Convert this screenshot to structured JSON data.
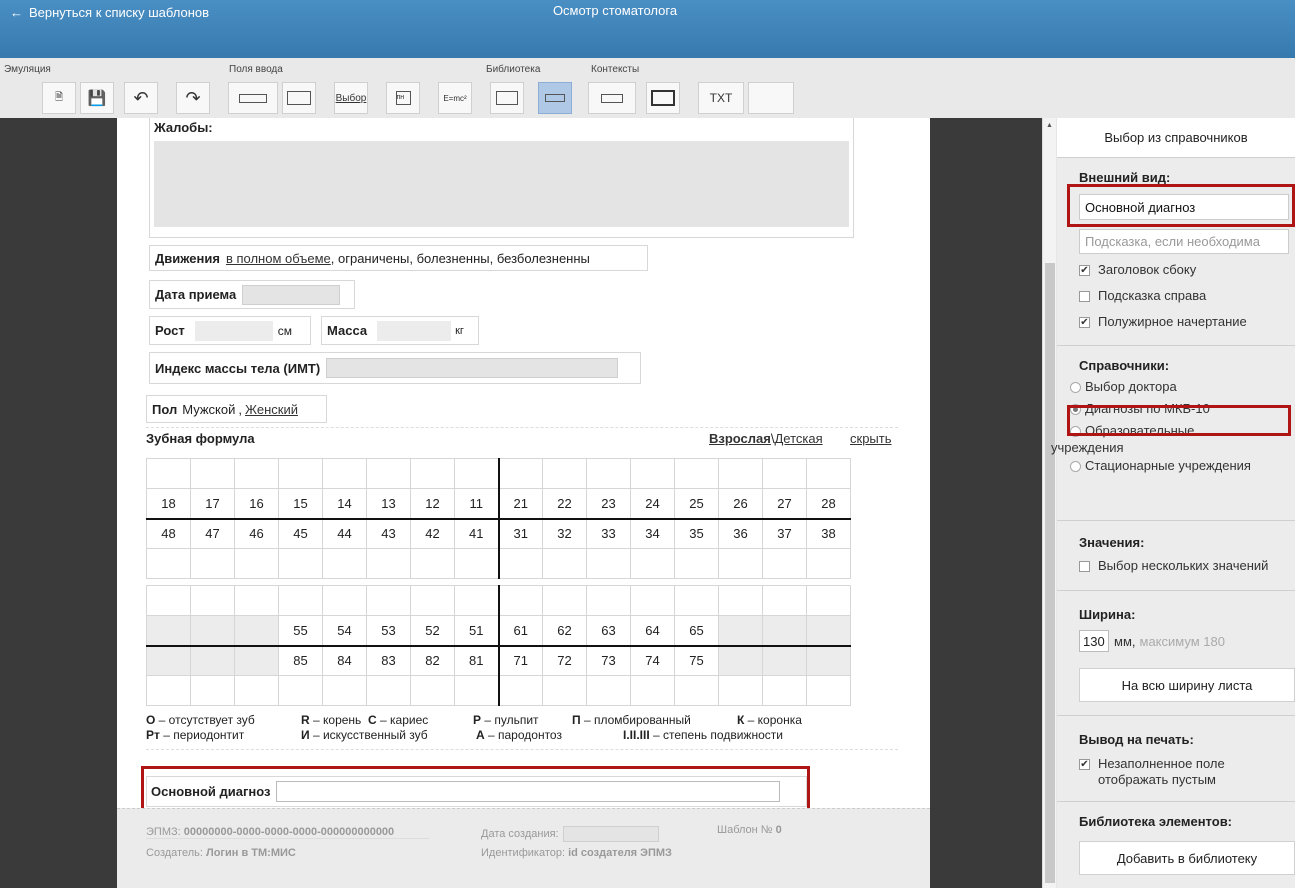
{
  "header": {
    "back_label": "Вернуться к списку шаблонов",
    "title": "Осмотр стоматолога"
  },
  "toolbar": {
    "groups": {
      "emulation": "Эмуляция",
      "input_fields": "Поля ввода",
      "library": "Библиотека",
      "contexts": "Контексты"
    },
    "choice_label": "Выбор",
    "pn_label": "пн",
    "formula_label": "E=mc²",
    "txt_label": "TXT"
  },
  "sheet": {
    "complaints_label": "Жалобы:",
    "movements": {
      "label": "Движения",
      "opt1": "в полном объеме",
      "rest": ", ограничены, болезненны, безболезненны"
    },
    "visit_date_label": "Дата приема",
    "height_label": "Рост",
    "height_unit": "см",
    "weight_label": "Масса",
    "weight_unit": "кг",
    "bmi_label": "Индекс массы тела (ИМТ)",
    "sex": {
      "label": "Пол",
      "opt1": "Мужской",
      "sep": ",",
      "opt2": "Женский"
    },
    "dental_formula": {
      "label": "Зубная формула",
      "adult": "Взрослая",
      "sep": "\\",
      "child": "Детская",
      "hide": "скрыть"
    },
    "teeth_upper": [
      "18",
      "17",
      "16",
      "15",
      "14",
      "13",
      "12",
      "11",
      "21",
      "22",
      "23",
      "24",
      "25",
      "26",
      "27",
      "28"
    ],
    "teeth_lower": [
      "48",
      "47",
      "46",
      "45",
      "44",
      "43",
      "42",
      "41",
      "31",
      "32",
      "33",
      "34",
      "35",
      "36",
      "37",
      "38"
    ],
    "milk_upper": [
      "",
      "",
      "",
      "55",
      "54",
      "53",
      "52",
      "51",
      "61",
      "62",
      "63",
      "64",
      "65",
      "",
      "",
      ""
    ],
    "milk_lower": [
      "",
      "",
      "",
      "85",
      "84",
      "83",
      "82",
      "81",
      "71",
      "72",
      "73",
      "74",
      "75",
      "",
      "",
      ""
    ],
    "legend": {
      "o_key": "О",
      "o_val": " – отсутствует зуб",
      "r_key": "R",
      "r_val": " – корень",
      "c_key": "C",
      "c_val": " – кариес",
      "p_key": "P",
      "p_val": " – пульпит",
      "pl_key": "П",
      "pl_val": " – пломбированный",
      "k_key": "К",
      "k_val": " – коронка",
      "rt_key": "Рт",
      "rt_val": " – периодонтит",
      "i_key": "И",
      "i_val": " – искусственный зуб",
      "a_key": "А",
      "a_val": " – пародонтоз",
      "m_key": "I.II.III",
      "m_val": " – степень подвижности"
    },
    "main_diag_label": "Основной диагноз"
  },
  "footer": {
    "epmz_label": "ЭПМЗ:",
    "epmz_value": "00000000-0000-0000-0000-000000000000",
    "created_label": "Дата создания:",
    "template_label": "Шаблон №",
    "template_value": "0",
    "creator_label": "Создатель:",
    "creator_value": "Логин в ТМ:МИС",
    "id_label": "Идентификатор:",
    "id_value": "id создателя ЭПМЗ"
  },
  "panel": {
    "title": "Выбор из справочников",
    "appearance_label": "Внешний вид:",
    "appearance_value": "Основной диагноз",
    "hint_placeholder": "Подсказка, если необходима",
    "cb_side_header": "Заголовок сбоку",
    "cb_hint_right": "Подсказка справа",
    "cb_bold": "Полужирное начертание",
    "refs_label": "Справочники:",
    "ref_doctor": "Выбор доктора",
    "ref_mkb": "Диагнозы по МКБ-10",
    "ref_edu_1": "Образовательные",
    "ref_edu_2": "учреждения",
    "ref_hosp": "Стационарные учреждения",
    "values_label": "Значения:",
    "cb_multi": "Выбор нескольких значений",
    "width_label": "Ширина:",
    "width_value": "130",
    "width_unit": "мм,",
    "width_max": "максимум 180",
    "full_width_btn": "На всю ширину листа",
    "print_label": "Вывод на печать:",
    "cb_empty_1": "Незаполненное поле",
    "cb_empty_2": "отображать пустым",
    "lib_label": "Библиотека элементов:",
    "add_lib_btn": "Добавить в библиотеку"
  }
}
